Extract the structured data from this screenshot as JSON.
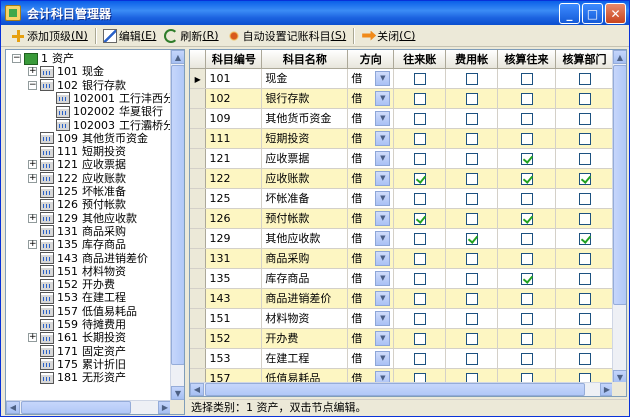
{
  "window": {
    "title": "会计科目管理器",
    "minimize": "_",
    "maximize": "□",
    "close": "✕"
  },
  "toolbar": {
    "add_top": {
      "label": "添加顶级",
      "key": "(N)",
      "icon": "plus-icon"
    },
    "edit": {
      "label": "编辑",
      "key": "(E)",
      "icon": "edit-icon"
    },
    "refresh": {
      "label": "刷新",
      "key": "(R)",
      "icon": "refresh-icon"
    },
    "auto_set": {
      "label": "自动设置记账科目",
      "key": "(S)",
      "icon": "setting-icon"
    },
    "close": {
      "label": "关闭",
      "key": "(C)",
      "icon": "exit-arrow-icon"
    }
  },
  "tree": {
    "nodes": [
      {
        "level": 0,
        "expander": "−",
        "code": "1",
        "name": "资产",
        "root": true
      },
      {
        "level": 1,
        "expander": "+",
        "code": "101",
        "name": "现金"
      },
      {
        "level": 1,
        "expander": "−",
        "code": "102",
        "name": "银行存款"
      },
      {
        "level": 2,
        "expander": "",
        "code": "102001",
        "name": "工行沣西分理"
      },
      {
        "level": 2,
        "expander": "",
        "code": "102002",
        "name": "华夏银行"
      },
      {
        "level": 2,
        "expander": "",
        "code": "102003",
        "name": "工行灞桥分理"
      },
      {
        "level": 1,
        "expander": "",
        "code": "109",
        "name": "其他货币资金"
      },
      {
        "level": 1,
        "expander": "",
        "code": "111",
        "name": "短期投资"
      },
      {
        "level": 1,
        "expander": "+",
        "code": "121",
        "name": "应收票据"
      },
      {
        "level": 1,
        "expander": "+",
        "code": "122",
        "name": "应收账款"
      },
      {
        "level": 1,
        "expander": "",
        "code": "125",
        "name": "坏帐准备"
      },
      {
        "level": 1,
        "expander": "",
        "code": "126",
        "name": "预付帐款"
      },
      {
        "level": 1,
        "expander": "+",
        "code": "129",
        "name": "其他应收款"
      },
      {
        "level": 1,
        "expander": "",
        "code": "131",
        "name": "商品采购"
      },
      {
        "level": 1,
        "expander": "+",
        "code": "135",
        "name": "库存商品"
      },
      {
        "level": 1,
        "expander": "",
        "code": "143",
        "name": "商品进销差价"
      },
      {
        "level": 1,
        "expander": "",
        "code": "151",
        "name": "材料物资"
      },
      {
        "level": 1,
        "expander": "",
        "code": "152",
        "name": "开办费"
      },
      {
        "level": 1,
        "expander": "",
        "code": "153",
        "name": "在建工程"
      },
      {
        "level": 1,
        "expander": "",
        "code": "157",
        "name": "低值易耗品"
      },
      {
        "level": 1,
        "expander": "",
        "code": "159",
        "name": "待摊费用"
      },
      {
        "level": 1,
        "expander": "+",
        "code": "161",
        "name": "长期投资"
      },
      {
        "level": 1,
        "expander": "",
        "code": "171",
        "name": "固定资产"
      },
      {
        "level": 1,
        "expander": "",
        "code": "175",
        "name": "累计折旧"
      },
      {
        "level": 1,
        "expander": "",
        "code": "181",
        "name": "无形资产"
      }
    ]
  },
  "grid": {
    "columns": [
      "科目编号",
      "科目名称",
      "方向",
      "往来账",
      "费用帐",
      "核算往来",
      "核算部门"
    ],
    "current_row_marker": "▶",
    "rows": [
      {
        "code": "101",
        "name": "现金",
        "dir": "借",
        "c1": false,
        "c2": false,
        "c3": false,
        "c4": false
      },
      {
        "code": "102",
        "name": "银行存款",
        "dir": "借",
        "c1": false,
        "c2": false,
        "c3": false,
        "c4": false
      },
      {
        "code": "109",
        "name": "其他货币资金",
        "dir": "借",
        "c1": false,
        "c2": false,
        "c3": false,
        "c4": false
      },
      {
        "code": "111",
        "name": "短期投资",
        "dir": "借",
        "c1": false,
        "c2": false,
        "c3": false,
        "c4": false
      },
      {
        "code": "121",
        "name": "应收票据",
        "dir": "借",
        "c1": false,
        "c2": false,
        "c3": true,
        "c4": false
      },
      {
        "code": "122",
        "name": "应收账款",
        "dir": "借",
        "c1": true,
        "c2": false,
        "c3": true,
        "c4": true
      },
      {
        "code": "125",
        "name": "坏帐准备",
        "dir": "借",
        "c1": false,
        "c2": false,
        "c3": false,
        "c4": false
      },
      {
        "code": "126",
        "name": "预付帐款",
        "dir": "借",
        "c1": true,
        "c2": false,
        "c3": true,
        "c4": false
      },
      {
        "code": "129",
        "name": "其他应收款",
        "dir": "借",
        "c1": false,
        "c2": true,
        "c3": false,
        "c4": true
      },
      {
        "code": "131",
        "name": "商品采购",
        "dir": "借",
        "c1": false,
        "c2": false,
        "c3": false,
        "c4": false
      },
      {
        "code": "135",
        "name": "库存商品",
        "dir": "借",
        "c1": false,
        "c2": false,
        "c3": true,
        "c4": false
      },
      {
        "code": "143",
        "name": "商品进销差价",
        "dir": "借",
        "c1": false,
        "c2": false,
        "c3": false,
        "c4": false
      },
      {
        "code": "151",
        "name": "材料物资",
        "dir": "借",
        "c1": false,
        "c2": false,
        "c3": false,
        "c4": false
      },
      {
        "code": "152",
        "name": "开办费",
        "dir": "借",
        "c1": false,
        "c2": false,
        "c3": false,
        "c4": false
      },
      {
        "code": "153",
        "name": "在建工程",
        "dir": "借",
        "c1": false,
        "c2": false,
        "c3": false,
        "c4": false
      },
      {
        "code": "157",
        "name": "低值易耗品",
        "dir": "借",
        "c1": false,
        "c2": false,
        "c3": false,
        "c4": false
      }
    ]
  },
  "status": {
    "text": "选择类别：1 资产，双击节点编辑。"
  }
}
